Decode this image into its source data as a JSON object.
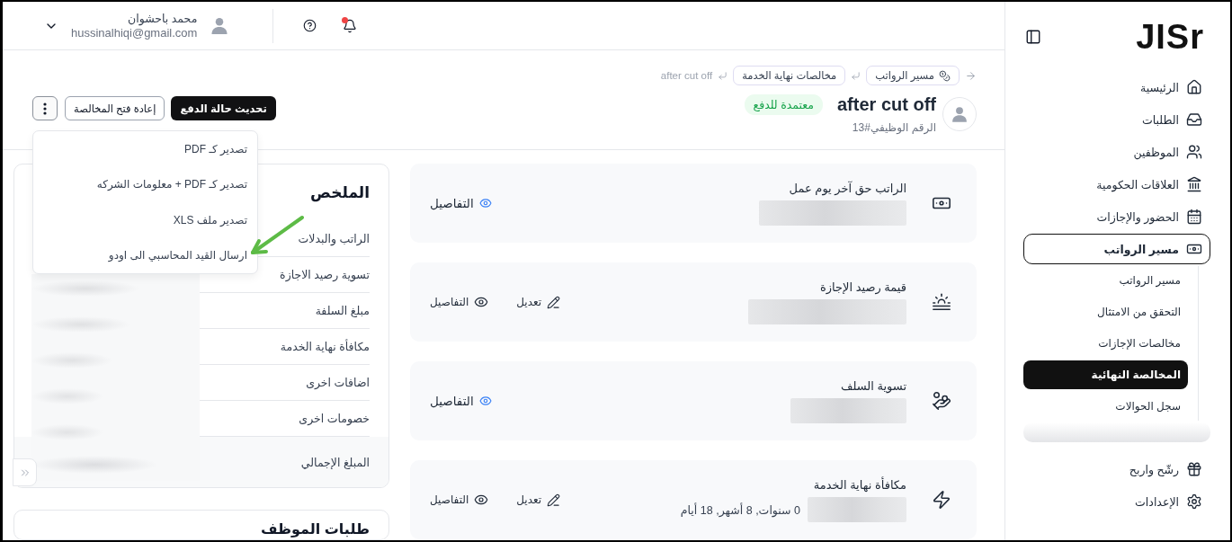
{
  "sidebar": {
    "logo": "JISr",
    "items": [
      {
        "label": "الرئيسية",
        "kind": "home",
        "selected": false,
        "expanded": false
      },
      {
        "label": "الطلبات",
        "kind": "requests",
        "selected": false,
        "expanded": false
      },
      {
        "label": "الموظفين",
        "kind": "employees",
        "selected": false,
        "expanded": false
      },
      {
        "label": "العلاقات الحكومية",
        "kind": "government",
        "selected": false,
        "expanded": false
      },
      {
        "label": "الحضور والإجازات",
        "kind": "attendance",
        "selected": false,
        "expanded": false
      },
      {
        "label": "مسير الرواتب",
        "kind": "payroll",
        "selected": false,
        "expanded": true,
        "children": [
          {
            "label": "مسير الرواتب",
            "selected": false
          },
          {
            "label": "التحقق من الامتثال",
            "selected": false
          },
          {
            "label": "مخالصات الإجازات",
            "selected": false
          },
          {
            "label": "المخالصة النهائية",
            "selected": true
          },
          {
            "label": "سجل الحوالات",
            "selected": false
          }
        ]
      },
      {
        "label": "رشّح واربح",
        "kind": "referral",
        "selected": false,
        "expanded": false
      },
      {
        "label": "الإعدادات",
        "kind": "settings",
        "selected": false,
        "expanded": false
      }
    ]
  },
  "top_bar": {
    "notifications_unread": true,
    "user": {
      "name": "محمد باحشوان",
      "email": "hussinalhiqi@gmail.com"
    }
  },
  "header": {
    "breadcrumb": [
      {
        "label": "مسير الرواتب",
        "kind": "section"
      },
      {
        "label": "مخالصات نهاية الخدمة",
        "kind": "link"
      },
      {
        "label": "after cut off",
        "kind": "current"
      }
    ],
    "title": "after cut off",
    "status": "معتمدة للدفع",
    "employee_number": "الرقم الوظيفي#13",
    "actions": [
      {
        "label": "تحديث حالة الدفع",
        "kind": "primary"
      },
      {
        "label": "إعادة فتح المخالصة",
        "kind": "outline"
      },
      {
        "kind": "more",
        "menu_open": true
      }
    ]
  },
  "export_menu": {
    "items": [
      {
        "label": "تصدير كـ PDF",
        "annotated": false
      },
      {
        "label": "تصدير كـ PDF + معلومات الشركه",
        "annotated": false
      },
      {
        "label": "تصدير ملف XLS",
        "annotated": false
      },
      {
        "label": "ارسال القيد المحاسبي الى اودو",
        "annotated": true
      }
    ]
  },
  "cards": [
    {
      "title": "الراتب حق آخر يوم عمل",
      "kind": "salary",
      "actions": [
        {
          "kind": "view-link",
          "label": "التفاصيل"
        }
      ]
    },
    {
      "title": "قيمة رصيد الإجازة",
      "kind": "leave",
      "actions": [
        {
          "kind": "edit",
          "label": "تعديل"
        },
        {
          "kind": "view",
          "label": "التفاصيل"
        }
      ]
    },
    {
      "title": "تسوية السلف",
      "kind": "advance",
      "actions": [
        {
          "kind": "view-link",
          "label": "التفاصيل"
        }
      ]
    },
    {
      "title": "مكافأة نهاية الخدمة",
      "kind": "end-of-service",
      "duration": "0 سنوات, 8 أشهر, 18 أيام",
      "actions": [
        {
          "kind": "edit",
          "label": "تعديل"
        },
        {
          "kind": "view",
          "label": "التفاصيل"
        }
      ]
    }
  ],
  "summary": {
    "title": "الملخص",
    "rows": [
      {
        "label": "الراتب والبدلات",
        "kind": "line"
      },
      {
        "label": "تسوية رصيد الاجازة",
        "kind": "line"
      },
      {
        "label": "مبلغ السلفة",
        "kind": "line"
      },
      {
        "label": "مكافأة نهاية الخدمة",
        "kind": "line"
      },
      {
        "label": "اضافات اخرى",
        "kind": "line"
      },
      {
        "label": "خصومات اخرى",
        "kind": "line"
      },
      {
        "label": "المبلغ الإجمالي",
        "kind": "total"
      }
    ]
  },
  "requests": {
    "title": "طلبات الموظف"
  }
}
